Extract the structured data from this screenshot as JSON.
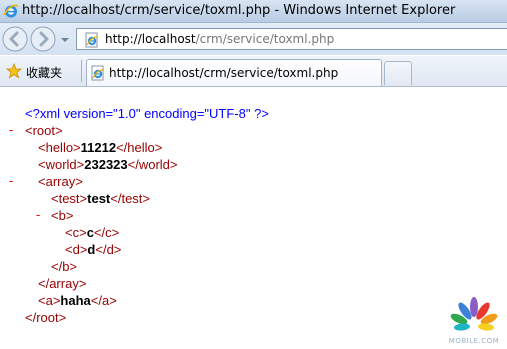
{
  "window": {
    "title": "http://localhost/crm/service/toxml.php - Windows Internet Explorer"
  },
  "navigation": {
    "address_host": "http://localhost",
    "address_path": "/crm/service/toxml.php"
  },
  "favorites": {
    "label": "收藏夹"
  },
  "tab": {
    "label": "http://localhost/crm/service/toxml.php"
  },
  "xml": {
    "declaration": "<?xml version=\"1.0\" encoding=\"UTF-8\" ?>",
    "toggle_symbol": "-",
    "lines": {
      "root_open": "<root>",
      "hello_open": "<hello>",
      "hello_value": "11212",
      "hello_close": "</hello>",
      "world_open": "<world>",
      "world_value": "232323",
      "world_close": "</world>",
      "array_open": "<array>",
      "test_open": "<test>",
      "test_value": "test",
      "test_close": "</test>",
      "b_open": "<b>",
      "c_open": "<c>",
      "c_value": "c",
      "c_close": "</c>",
      "d_open": "<d>",
      "d_value": "d",
      "d_close": "</d>",
      "b_close": "</b>",
      "array_close": "</array>",
      "a_open": "<a>",
      "a_value": "haha",
      "a_close": "</a>",
      "root_close": "</root>"
    }
  },
  "watermark": {
    "text": "MOBILE.COM"
  },
  "colors": {
    "pi": "#0000ff",
    "tag": "#990000",
    "toggle": "#ff0000",
    "value": "#000000"
  }
}
